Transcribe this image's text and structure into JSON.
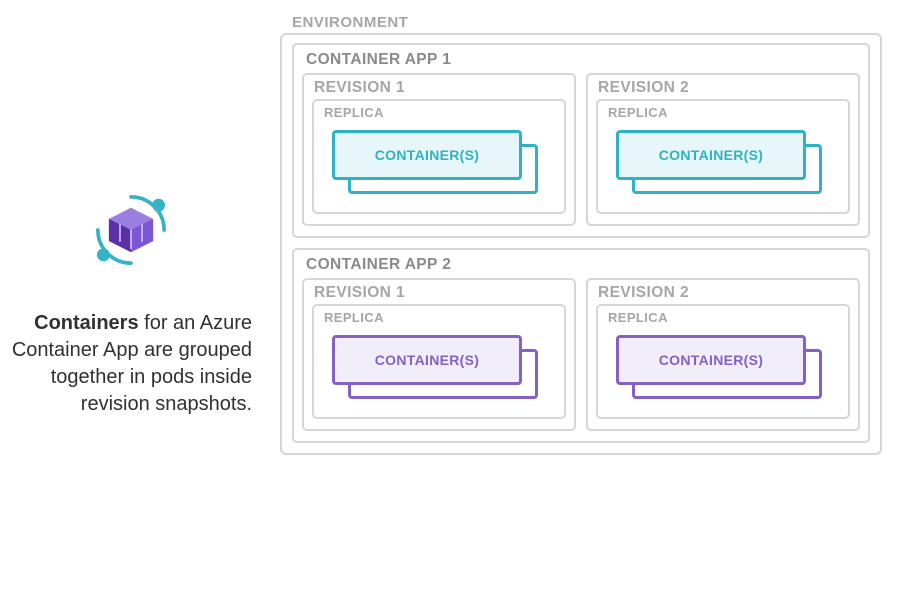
{
  "blurb": {
    "lead": "Containers",
    "rest": " for an Azure Container App are grouped together in pods inside revision snapshots."
  },
  "environment": {
    "label": "ENVIRONMENT",
    "apps": [
      {
        "label": "CONTAINER APP 1",
        "theme": "teal",
        "revisions": [
          {
            "label": "REVISION 1",
            "replica": "REPLICA",
            "container": "CONTAINER(S)"
          },
          {
            "label": "REVISION 2",
            "replica": "REPLICA",
            "container": "CONTAINER(S)"
          }
        ]
      },
      {
        "label": "CONTAINER APP 2",
        "theme": "purple",
        "revisions": [
          {
            "label": "REVISION 1",
            "replica": "REPLICA",
            "container": "CONTAINER(S)"
          },
          {
            "label": "REVISION 2",
            "replica": "REPLICA",
            "container": "CONTAINER(S)"
          }
        ]
      }
    ]
  }
}
